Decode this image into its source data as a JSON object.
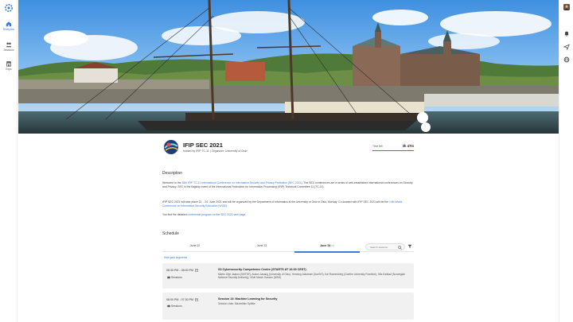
{
  "nav": {
    "items": [
      {
        "label": "Reception",
        "icon": "home-icon",
        "active": true
      },
      {
        "label": "Sessions",
        "icon": "people-icon",
        "active": false
      },
      {
        "label": "Expo",
        "icon": "store-icon",
        "active": false
      }
    ]
  },
  "rail": {
    "icons": [
      "avatar-icon",
      "bell-icon",
      "send-icon",
      "globe-icon"
    ]
  },
  "event": {
    "title": "IFIP SEC 2021",
    "subtitle": "hosted by IFIP TC-11 | Organizer: University of Oslo",
    "time_left_label": "Time left",
    "time_left_value": "3h 47m"
  },
  "description": {
    "heading": "Description",
    "p1_prefix": "Welcome to the ",
    "p1_link": "36th IFIP TC-11 International Conference on Information Security and Privacy Protection (SEC 2021)",
    "p1_suffix": ". The SEC conferences are a series of well-established international conferences on Security and Privacy. SEC is the flagship event of the International Federation for Information Processing (IFIP) Technical Committee 11 (TC-11).",
    "p2_prefix": "IFIP SEC 2021 will take place 22. - 24. June 2021 and will be organized by the Department of Informatics at the University of Oslo in Oslo, Norway. Co-located with IFIP SEC 2021 will be the ",
    "p2_link": "14th World Conference on Information Security Education (WISE)",
    "p2_suffix": ".",
    "p3_prefix": "You find the detailed ",
    "p3_link": "conference program on the SEC 2021 web page",
    "p3_suffix": "."
  },
  "schedule": {
    "heading": "Schedule",
    "tabs": [
      "June 22",
      "June 23",
      "June 24"
    ],
    "today_badge": "(T)",
    "search_placeholder": "Search sessions",
    "hide_past": "Hide past segments",
    "sessions": [
      {
        "time": "08:30 PM - 08:00 PM",
        "kind": "Sessions",
        "title": "S3 Cybersecurity Competence Centre (STARTS AT 16:00 CEST)",
        "desc": "Martin Gilje Jaatun (SINTEF), Audun Jøsang (University of Oslo), Henning Jakobsen (NorSIS), Kai Rannenberg (Goethe University Frankfurt), Nils Kalstad (Norwegian National Security Authority), Vilde Mørch Hansen (NSM)"
      },
      {
        "time": "06:00 PM - 07:30 PM",
        "kind": "Sessions",
        "title": "Session 13: Machine Learning for Security",
        "desc": "Session chair: Maximilian Spöttle"
      }
    ]
  }
}
